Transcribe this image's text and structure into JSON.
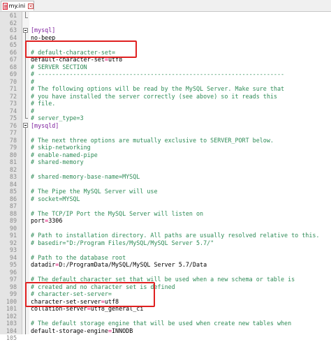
{
  "tab": {
    "label": "my.ini",
    "icon": "ini-file-icon",
    "close_icon": "close-icon"
  },
  "colors": {
    "comment": "#2e8b57",
    "section": "#7d1f9d",
    "operator": "#e0006a",
    "highlight_box": "#e02020"
  },
  "lines": [
    {
      "n": "61",
      "type": "blank",
      "text": ""
    },
    {
      "n": "62",
      "type": "blank",
      "text": ""
    },
    {
      "n": "63",
      "type": "section",
      "text": "[mysql]"
    },
    {
      "n": "64",
      "type": "plain",
      "text": "no-beep"
    },
    {
      "n": "65",
      "type": "blank",
      "text": ""
    },
    {
      "n": "66",
      "type": "comment",
      "text": "# default-character-set="
    },
    {
      "n": "67",
      "type": "kv",
      "key": "default-character-set",
      "value": "utf8"
    },
    {
      "n": "68",
      "type": "comment",
      "text": "# SERVER SECTION"
    },
    {
      "n": "69",
      "type": "comment",
      "text": "# ----------------------------------------------------------------------"
    },
    {
      "n": "70",
      "type": "comment",
      "text": "#"
    },
    {
      "n": "71",
      "type": "comment",
      "text": "# The following options will be read by the MySQL Server. Make sure that"
    },
    {
      "n": "72",
      "type": "comment",
      "text": "# you have installed the server correctly (see above) so it reads this"
    },
    {
      "n": "73",
      "type": "comment",
      "text": "# file."
    },
    {
      "n": "74",
      "type": "comment",
      "text": "#"
    },
    {
      "n": "75",
      "type": "comment",
      "text": "# server_type=3"
    },
    {
      "n": "76",
      "type": "section",
      "text": "[mysqld]"
    },
    {
      "n": "77",
      "type": "blank",
      "text": ""
    },
    {
      "n": "78",
      "type": "comment",
      "text": "# The next three options are mutually exclusive to SERVER_PORT below."
    },
    {
      "n": "79",
      "type": "comment",
      "text": "# skip-networking"
    },
    {
      "n": "80",
      "type": "comment",
      "text": "# enable-named-pipe"
    },
    {
      "n": "81",
      "type": "comment",
      "text": "# shared-memory"
    },
    {
      "n": "82",
      "type": "blank",
      "text": ""
    },
    {
      "n": "83",
      "type": "comment",
      "text": "# shared-memory-base-name=MYSQL"
    },
    {
      "n": "84",
      "type": "blank",
      "text": ""
    },
    {
      "n": "85",
      "type": "comment",
      "text": "# The Pipe the MySQL Server will use"
    },
    {
      "n": "86",
      "type": "comment",
      "text": "# socket=MYSQL"
    },
    {
      "n": "87",
      "type": "blank",
      "text": ""
    },
    {
      "n": "88",
      "type": "comment",
      "text": "# The TCP/IP Port the MySQL Server will listen on"
    },
    {
      "n": "89",
      "type": "kv",
      "key": "port",
      "value": "3306"
    },
    {
      "n": "90",
      "type": "blank",
      "text": ""
    },
    {
      "n": "91",
      "type": "comment",
      "text": "# Path to installation directory. All paths are usually resolved relative to this."
    },
    {
      "n": "92",
      "type": "comment",
      "text": "# basedir=\"D:/Program Files/MySQL/MySQL Server 5.7/\""
    },
    {
      "n": "93",
      "type": "blank",
      "text": ""
    },
    {
      "n": "94",
      "type": "comment",
      "text": "# Path to the database root"
    },
    {
      "n": "95",
      "type": "kv",
      "key": "datadir",
      "value": "D:/ProgramData/MySQL/MySQL Server 5.7/Data"
    },
    {
      "n": "96",
      "type": "blank",
      "text": ""
    },
    {
      "n": "97",
      "type": "comment",
      "text": "# The default character set that will be used when a new schema or table is"
    },
    {
      "n": "98",
      "type": "comment",
      "text": "# created and no character set is defined"
    },
    {
      "n": "99",
      "type": "comment",
      "text": "# character-set-server="
    },
    {
      "n": "100",
      "type": "kv",
      "key": "character-set-server",
      "value": "utf8"
    },
    {
      "n": "101",
      "type": "kv",
      "key": "collation-server",
      "value": "utf8_general_ci"
    },
    {
      "n": "102",
      "type": "blank",
      "text": ""
    },
    {
      "n": "103",
      "type": "comment",
      "text": "# The default storage engine that will be used when create new tables when"
    },
    {
      "n": "104",
      "type": "kv",
      "key": "default-storage-engine",
      "value": "INNODB"
    },
    {
      "n": "105",
      "type": "blank",
      "text": ""
    }
  ]
}
